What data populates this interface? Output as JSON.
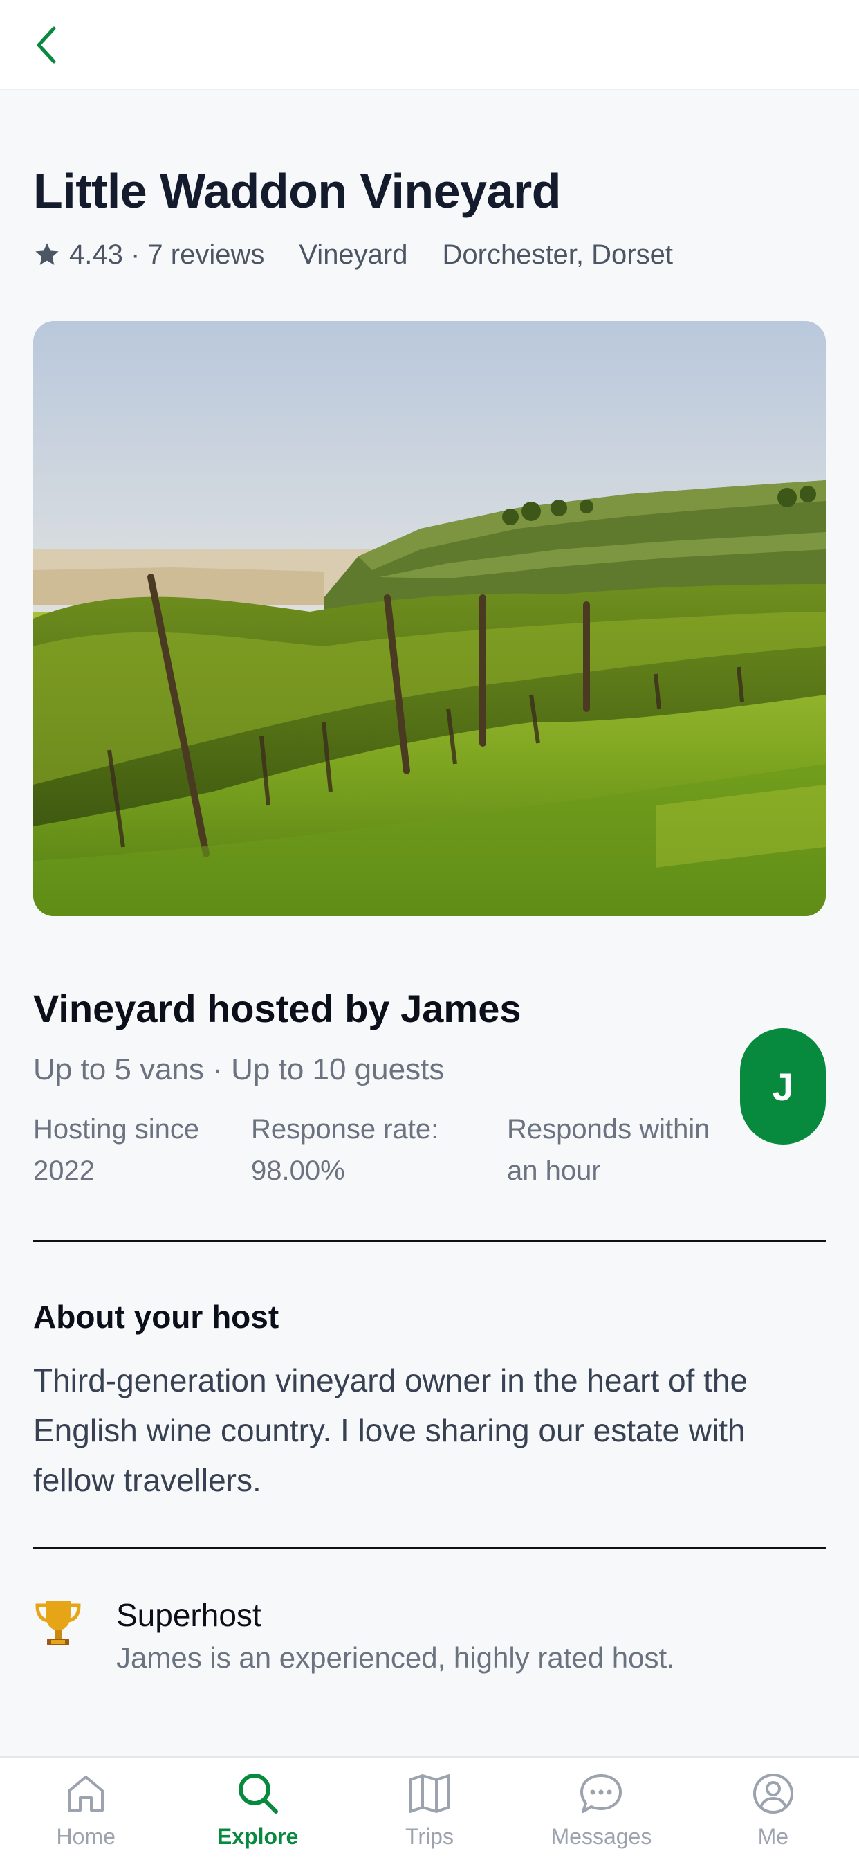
{
  "header": {
    "back_icon": "chevron-left-icon"
  },
  "listing": {
    "title": "Little Waddon Vineyard",
    "rating": "4.43 · 7 reviews",
    "type": "Vineyard",
    "location": "Dorchester, Dorset"
  },
  "host": {
    "title": "Vineyard hosted by James",
    "capacity": "Up to 5 vans · Up to 10 guests",
    "hosting_since": "Hosting since 2022",
    "response_rate": "Response rate: 98.00%",
    "response_time": "Responds within an hour",
    "avatar_initial": "J"
  },
  "about": {
    "title": "About your host",
    "text": "Third-generation vineyard owner in the heart of the English wine country. I love sharing our estate with fellow travellers."
  },
  "superhost": {
    "title": "Superhost",
    "text": "James is an experienced, highly rated host."
  },
  "tabs": [
    {
      "label": "Home",
      "icon": "home-icon"
    },
    {
      "label": "Explore",
      "icon": "search-icon"
    },
    {
      "label": "Trips",
      "icon": "map-icon"
    },
    {
      "label": "Messages",
      "icon": "chat-bubble-icon"
    },
    {
      "label": "Me",
      "icon": "user-circle-icon"
    }
  ],
  "colors": {
    "accent": "#078a3e",
    "inactive": "#9ca3af"
  }
}
